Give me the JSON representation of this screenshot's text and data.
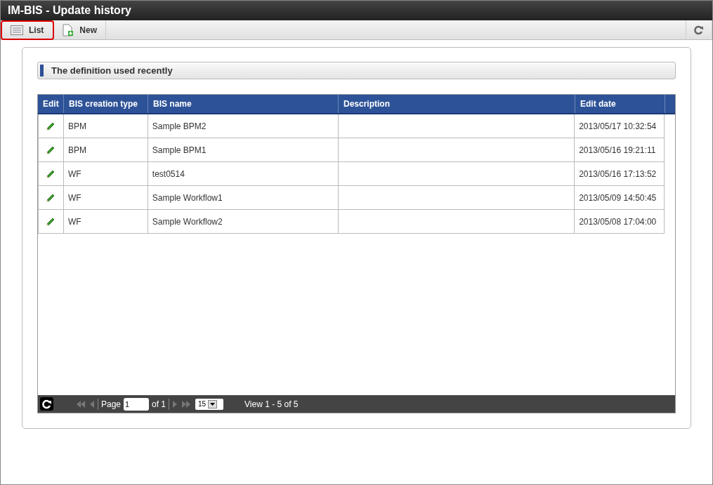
{
  "window": {
    "title": "IM-BIS - Update history"
  },
  "toolbar": [
    {
      "label": "List",
      "kind": "list",
      "selected": true
    },
    {
      "label": "New",
      "kind": "new",
      "selected": false
    }
  ],
  "section": {
    "title": "The definition used recently"
  },
  "table": {
    "columns": [
      "Edit",
      "BIS creation type",
      "BIS name",
      "Description",
      "Edit date"
    ],
    "rows": [
      [
        "",
        "BPM",
        "Sample BPM2",
        "",
        "2013/05/17 10:32:54"
      ],
      [
        "",
        "BPM",
        "Sample BPM1",
        "",
        "2013/05/16 19:21:11"
      ],
      [
        "",
        "WF",
        "test0514",
        "",
        "2013/05/16 17:13:52"
      ],
      [
        "",
        "WF",
        "Sample Workflow1",
        "",
        "2013/05/09 14:50:45"
      ],
      [
        "",
        "WF",
        "Sample Workflow2",
        "",
        "2013/05/08 17:04:00"
      ]
    ]
  },
  "pager": {
    "page_label": "Page",
    "page": "1",
    "of": "of 1",
    "page_size": "15",
    "summary": "View 1 - 5 of 5"
  }
}
